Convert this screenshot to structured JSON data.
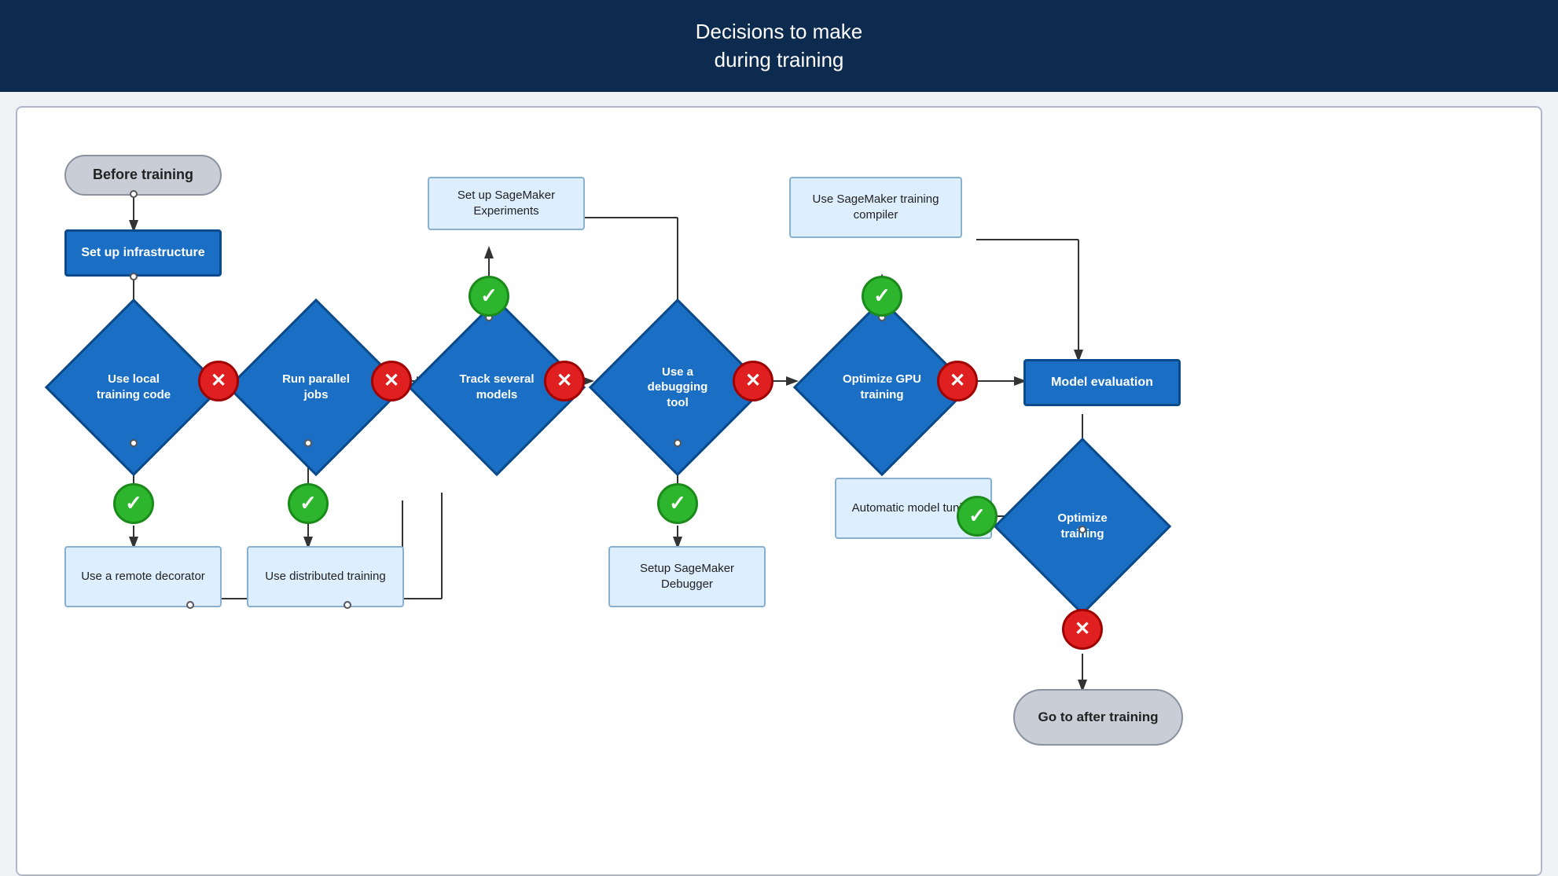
{
  "header": {
    "line1": "Decisions to make",
    "line2": "during training"
  },
  "nodes": {
    "before_training": "Before training",
    "set_up_infra": "Set up infrastructure",
    "use_local_training": "Use local\ntraining code",
    "use_remote_decorator": "Use a remote\ndecorator",
    "run_parallel_jobs": "Run parallel\njobs",
    "use_distributed_training": "Use distributed\ntraining",
    "track_several_models": "Track several\nmodels",
    "set_up_sagemaker_exp": "Set up SageMaker\nExperiments",
    "use_debugging_tool": "Use a\ndebugging\ntool",
    "setup_sagemaker_debugger": "Setup SageMaker\nDebugger",
    "optimize_gpu_training": "Optimize GPU\ntraining",
    "use_sagemaker_compiler": "Use SageMaker\ntraining compiler",
    "model_evaluation": "Model evaluation",
    "optimize_training": "Optimize\ntraining",
    "automatic_model_tuning": "Automatic model\ntuning",
    "go_to_after_training": "Go to after\ntraining"
  }
}
